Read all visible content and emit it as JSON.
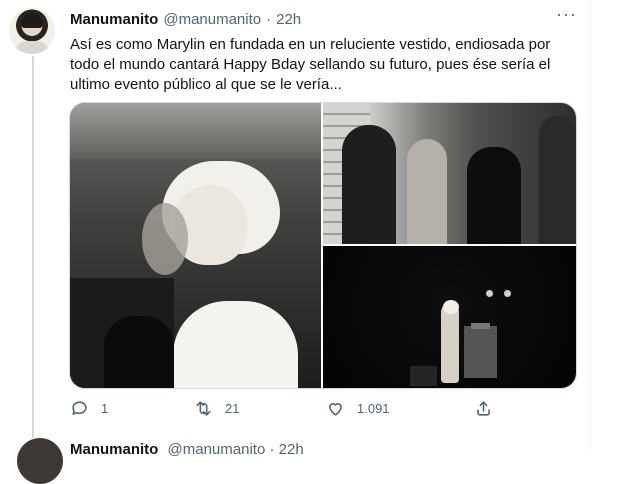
{
  "tweet": {
    "display_name": "Manumanito",
    "handle": "@manumanito",
    "separator": "·",
    "time": "22h",
    "more_icon": "more-horizontal-icon",
    "text_lines": [
      "Así es como Marylin en fundada en un reluciente vestido, endiosada por",
      "todo el mundo cantará Happy Bday sellando su futuro, pues ése sería el",
      "ultimo evento público al que se le vería..."
    ],
    "media": [
      {
        "name": "photo-marilyn-portrait",
        "type": "black-and-white photo"
      },
      {
        "name": "photo-kennedy-room",
        "type": "black-and-white photo"
      },
      {
        "name": "photo-stage-performance",
        "type": "black-and-white photo"
      }
    ],
    "actions": {
      "reply": {
        "icon": "reply-icon",
        "count": "1"
      },
      "retweet": {
        "icon": "retweet-icon",
        "count": "21"
      },
      "like": {
        "icon": "heart-icon",
        "count": "1.091"
      },
      "share": {
        "icon": "share-icon",
        "count": ""
      }
    }
  },
  "next_tweet": {
    "display_name": "Manumanito",
    "handle": "@manumanito",
    "separator": "·",
    "time": "22h"
  },
  "colors": {
    "text_primary": "#0f1419",
    "text_secondary": "#536471",
    "border": "#cfd9de"
  }
}
